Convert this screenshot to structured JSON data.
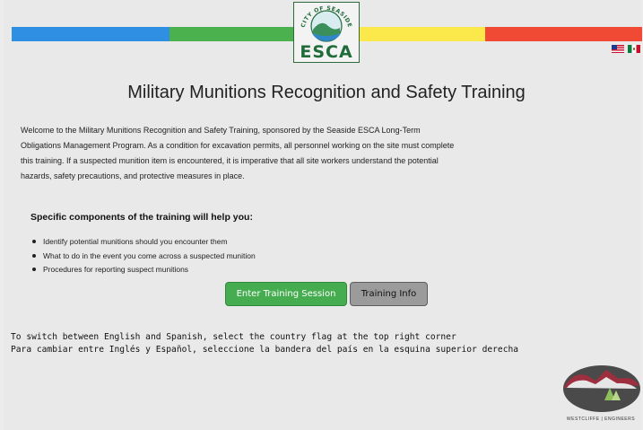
{
  "header": {
    "logo": {
      "arc_text": "CITY OF SEASIDE",
      "name": "ESCA"
    },
    "stripe_colors": [
      "#2f8fe3",
      "#4ab14e",
      "#fbe84a",
      "#f04a35"
    ],
    "flags": [
      {
        "icon": "us-flag-icon",
        "language": "English"
      },
      {
        "icon": "mexico-flag-icon",
        "language": "Spanish"
      }
    ]
  },
  "main": {
    "title": "Military Munitions Recognition and Safety Training",
    "intro_lines": [
      "Welcome to the Military Munitions Recognition and Safety Training, sponsored by the Seaside ESCA Long-Term",
      "Obligations Management Program. As a condition for excavation permits, all personnel working on the site must complete",
      "this training. If a suspected munition item is encountered, it is imperative that all site workers understand the potential",
      "hazards, safety precautions, and protective measures in place."
    ],
    "subheading": "Specific components of the training will help you:",
    "bullets": [
      "Identify potential munitions should you encounter them",
      "What to do in the event you come across a suspected munition",
      "Procedures for reporting suspect munitions"
    ],
    "buttons": {
      "enter": "Enter Training Session",
      "info": "Training Info"
    },
    "switch_lines": [
      "To switch between English and Spanish, select the country flag at the top right corner",
      "Para cambiar entre Inglés y Español, seleccione la bandera del país en la esquina superior derecha"
    ]
  },
  "footer": {
    "logo_text": "WESTCLIFFE | ENGINEERS"
  },
  "colors": {
    "accent_green": "#45ad4f",
    "secondary_gray": "#9b9b9b",
    "brand_green": "#1f6b3a"
  }
}
